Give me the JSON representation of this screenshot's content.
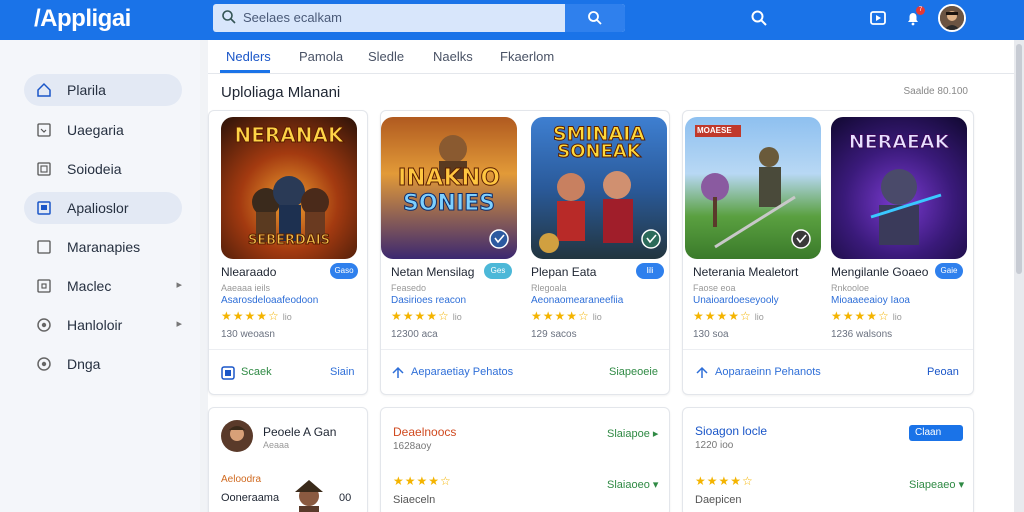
{
  "header": {
    "logo": "/Appligai",
    "search_placeholder": "Seelaes ecalkam",
    "notification_count": "7"
  },
  "sidebar": {
    "items": [
      {
        "label": "Plarila",
        "icon": "home-icon",
        "active": true,
        "chevron": false
      },
      {
        "label": "Uaegaria",
        "icon": "image-icon",
        "active": false,
        "chevron": false
      },
      {
        "label": "Soiodeia",
        "icon": "gallery-icon",
        "active": false,
        "chevron": false
      },
      {
        "label": "Apalioslor",
        "icon": "app-icon",
        "active": true,
        "chevron": false
      },
      {
        "label": "Maranapies",
        "icon": "square-icon",
        "active": false,
        "chevron": false
      },
      {
        "label": "Maclec",
        "icon": "frame-icon",
        "active": false,
        "chevron": true
      },
      {
        "label": "Hanloloir",
        "icon": "circle-icon",
        "active": false,
        "chevron": true
      },
      {
        "label": "Dnga",
        "icon": "circle-icon",
        "active": false,
        "chevron": false
      }
    ]
  },
  "tabs": [
    "Nedlers",
    "Pamola",
    "Sledle",
    "Naelks",
    "Fkaerlom"
  ],
  "section": {
    "title": "Uploliaga Mlanani",
    "meta": "Saalde 80.100"
  },
  "apps": [
    {
      "art_title": "NERANAK",
      "art_sub": "SEBERDAIS",
      "name": "Nlearaado",
      "pill": "Gaso",
      "developer": "Aaeaaa ieils",
      "subtitle": "Asarosdeloaafeodoon",
      "rating": "4.0",
      "rating_count": "lio",
      "downloads": "130 weoasn",
      "action_left": "Scaek",
      "action_right": "Siain"
    },
    {
      "art_title": "INAKNO",
      "art_sub": "SONIES",
      "name": "Netan Mensilag",
      "pill": "Ges",
      "developer": "Feasedo",
      "subtitle": "Dasirioes reacon",
      "rating": "4.0",
      "rating_count": "lio",
      "downloads": "12300 aca",
      "action_left": "Aeparaetiay Pehatos",
      "action_right": "Siapeoeie"
    },
    {
      "art_title": "SMINAIA",
      "art_sub": "SONEAK",
      "name": "Plepan Eata",
      "pill": "lili",
      "developer": "Rlegoala",
      "subtitle": "Aeonaomearaneefiia",
      "rating": "4.0",
      "rating_count": "lio",
      "downloads": "129 sacos",
      "action_left": "",
      "action_right": ""
    },
    {
      "art_title": "MOAESE",
      "art_sub": "",
      "name": "Neterania Mealetort",
      "pill": "",
      "developer": "Faose eoa",
      "subtitle": "Unaioardoeseyooly",
      "rating": "4.0",
      "rating_count": "lio",
      "downloads": "130 soa",
      "action_left": "Aoparaeinn Pehanots",
      "action_right": "Peoan"
    },
    {
      "art_title": "NERAEAK",
      "art_sub": "",
      "name": "Mengilanle Goaeo",
      "pill": "Gaie",
      "developer": "Rnkooloe",
      "subtitle": "Mioaaeeaioy Iaoa",
      "rating": "4.0",
      "rating_count": "lio",
      "downloads": "1236 walsons",
      "action_left": "",
      "action_right": ""
    }
  ],
  "row2": [
    {
      "title": "Peoele A Gan",
      "subtitle": "Aeaaa",
      "tag": "Aeloodra",
      "line": "Ooneraama",
      "num": "00"
    },
    {
      "title": "Deaelnoocs",
      "subtitle": "1628aoy",
      "tag": "Slaiapoe",
      "line": "Siaeceln",
      "num": "4.0",
      "tag2": "Slaiaoeo"
    },
    {
      "title": "Sioagon locle",
      "subtitle": "1220 ioo",
      "tag": "Claan",
      "line": "Daepicen",
      "num": "4.0",
      "tag2": "Siapeaeo"
    }
  ],
  "colors": {
    "brand": "#1a73e8",
    "rating": "#f4b400",
    "link": "#2f6fd8",
    "success": "#2f8a44"
  }
}
